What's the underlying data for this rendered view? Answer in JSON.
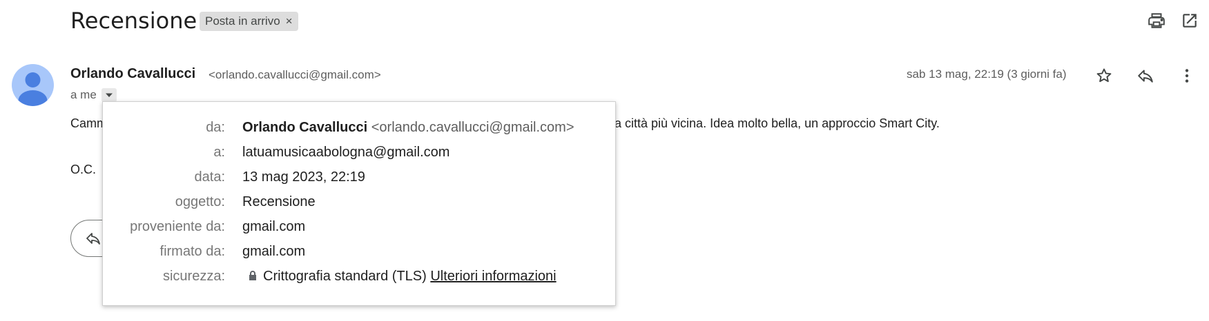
{
  "header": {
    "subject": "Recensione",
    "label_chip": "Posta in arrivo",
    "label_remove": "×",
    "icons": [
      "print-icon",
      "open-in-new-window-icon"
    ]
  },
  "message": {
    "sender_name": "Orlando Cavallucci",
    "sender_email": "<orlando.cavallucci@gmail.com>",
    "to": "a me",
    "date": "sab 13 mag, 22:19 (3 giorni fa)",
    "icons": [
      "star-icon",
      "reply-icon",
      "more-vert-icon"
    ],
    "body_start": "Camm",
    "body_rest": "a città più vicina. Idea molto bella, un approccio Smart City.",
    "signature": "O.C."
  },
  "details_popup": {
    "rows": [
      {
        "label": "da:",
        "name": "Orlando Cavallucci",
        "email": "<orlando.cavallucci@gmail.com>"
      },
      {
        "label": "a:",
        "value": "latuamusicaabologna@gmail.com"
      },
      {
        "label": "data:",
        "value": "13 mag 2023, 22:19"
      },
      {
        "label": "oggetto:",
        "value": "Recensione"
      },
      {
        "label": "proveniente da:",
        "value": "gmail.com"
      },
      {
        "label": "firmato da:",
        "value": "gmail.com"
      },
      {
        "label": "sicurezza:",
        "value": "Crittografia standard (TLS)",
        "link": "Ulteriori informazioni"
      }
    ]
  },
  "colors": {
    "avatar_bg": "#a8c7fa",
    "avatar_fg": "#4a7fe0",
    "chip_bg": "#dddddd"
  }
}
